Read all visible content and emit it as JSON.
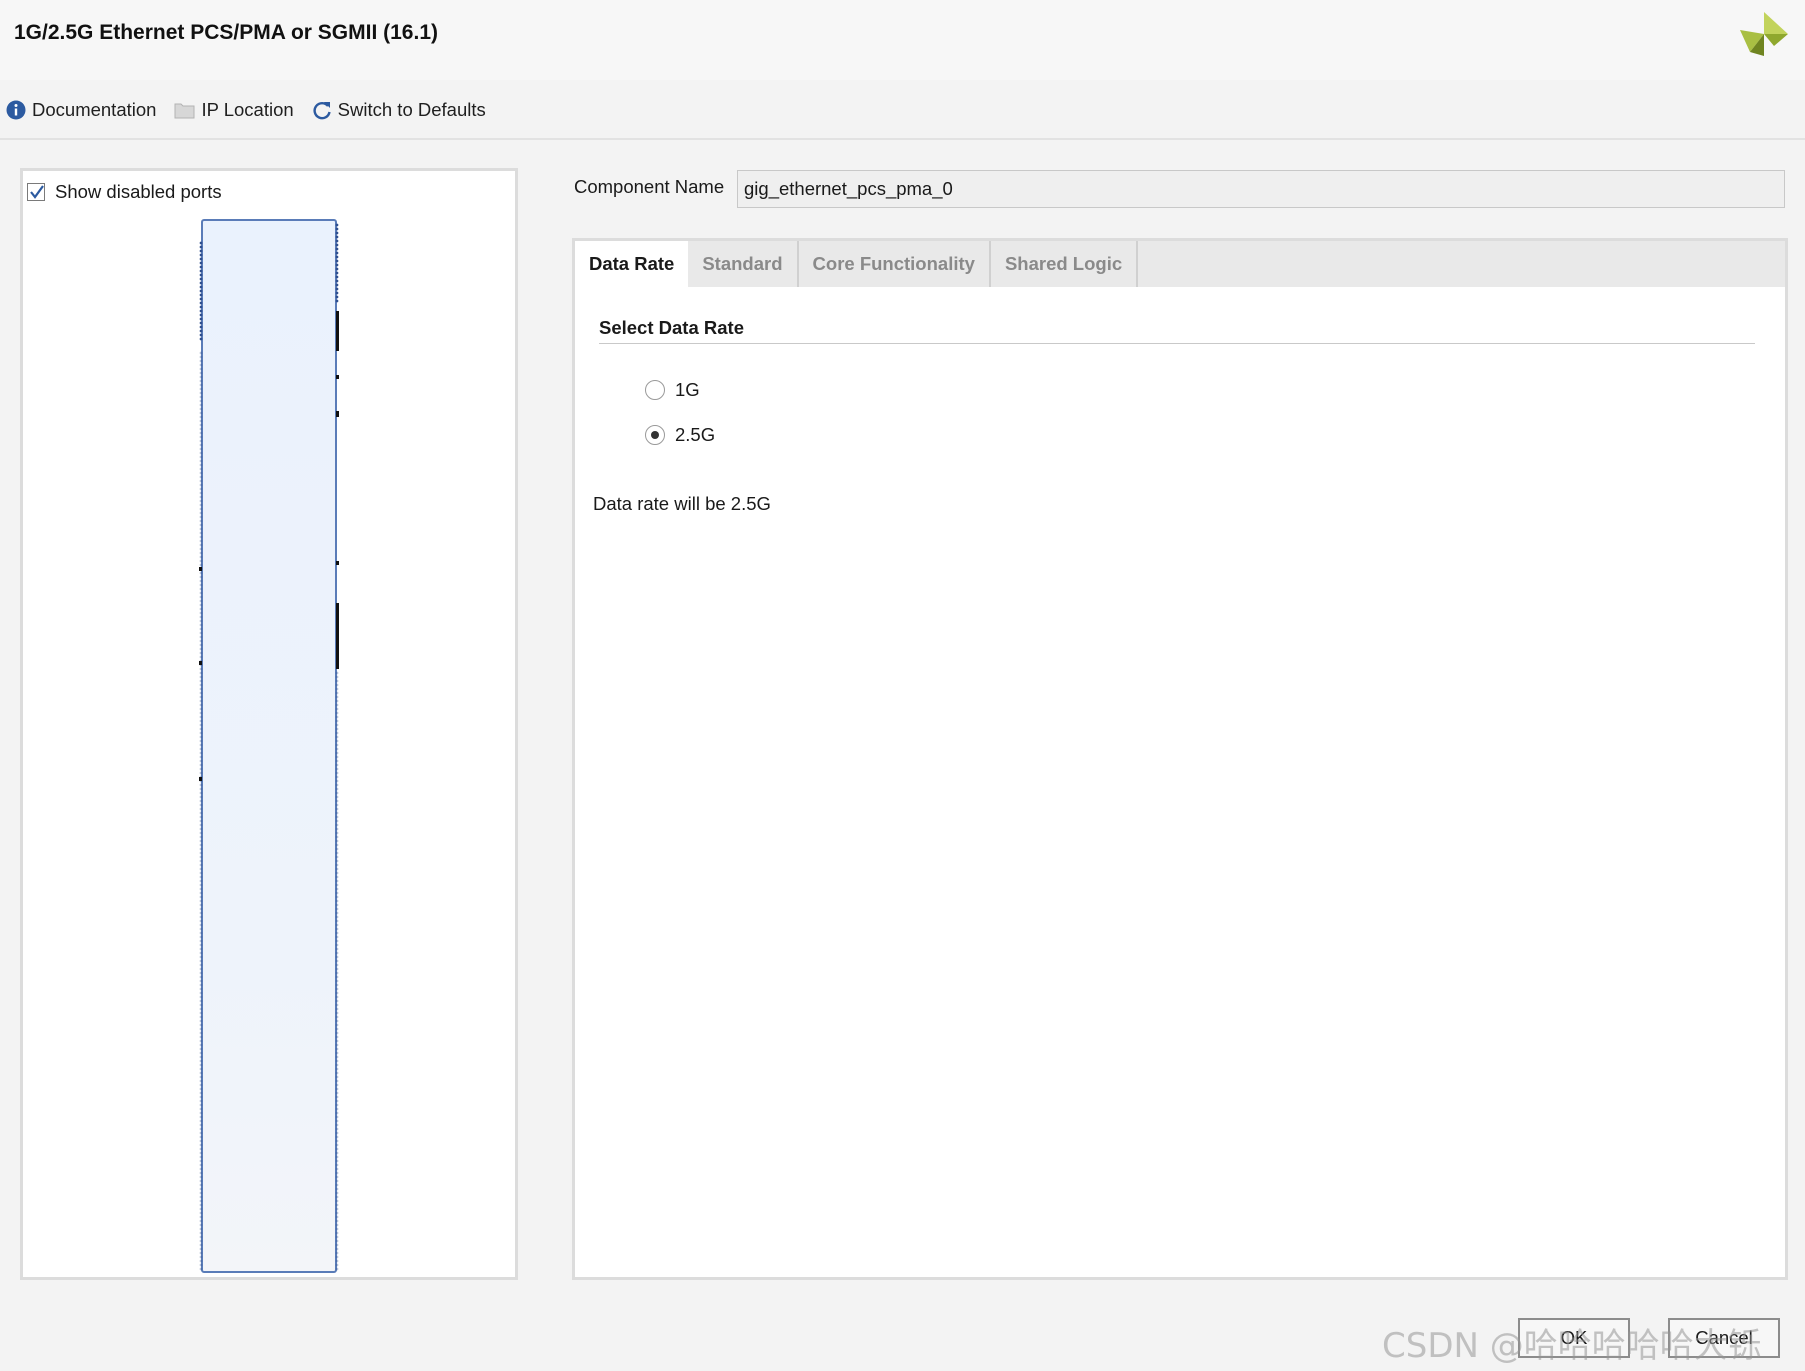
{
  "window": {
    "title": "1G/2.5G Ethernet PCS/PMA or SGMII (16.1)",
    "logo_icon": "xilinx-logo"
  },
  "toolbar": {
    "documentation_label": "Documentation",
    "ip_location_label": "IP Location",
    "switch_defaults_label": "Switch to Defaults"
  },
  "left_panel": {
    "show_disabled_ports_label": "Show disabled ports",
    "show_disabled_ports_checked": true
  },
  "component": {
    "label": "Component Name",
    "value": "gig_ethernet_pcs_pma_0"
  },
  "tabs": [
    {
      "label": "Data Rate",
      "active": true
    },
    {
      "label": "Standard",
      "active": false
    },
    {
      "label": "Core Functionality",
      "active": false
    },
    {
      "label": "Shared Logic",
      "active": false
    }
  ],
  "data_rate": {
    "section_title": "Select Data Rate",
    "options": [
      {
        "label": "1G",
        "selected": false
      },
      {
        "label": "2.5G",
        "selected": true
      }
    ],
    "info": "Data rate will be 2.5G"
  },
  "buttons": {
    "ok": "OK",
    "cancel": "Cancel"
  },
  "watermark": "CSDN @哈哈哈哈哈大铄",
  "colors": {
    "symbol_border": "#5a7cb8",
    "symbol_fill": "#eaf2fd",
    "logo_green": "#9cb33a",
    "info_blue": "#2c5aa0"
  }
}
